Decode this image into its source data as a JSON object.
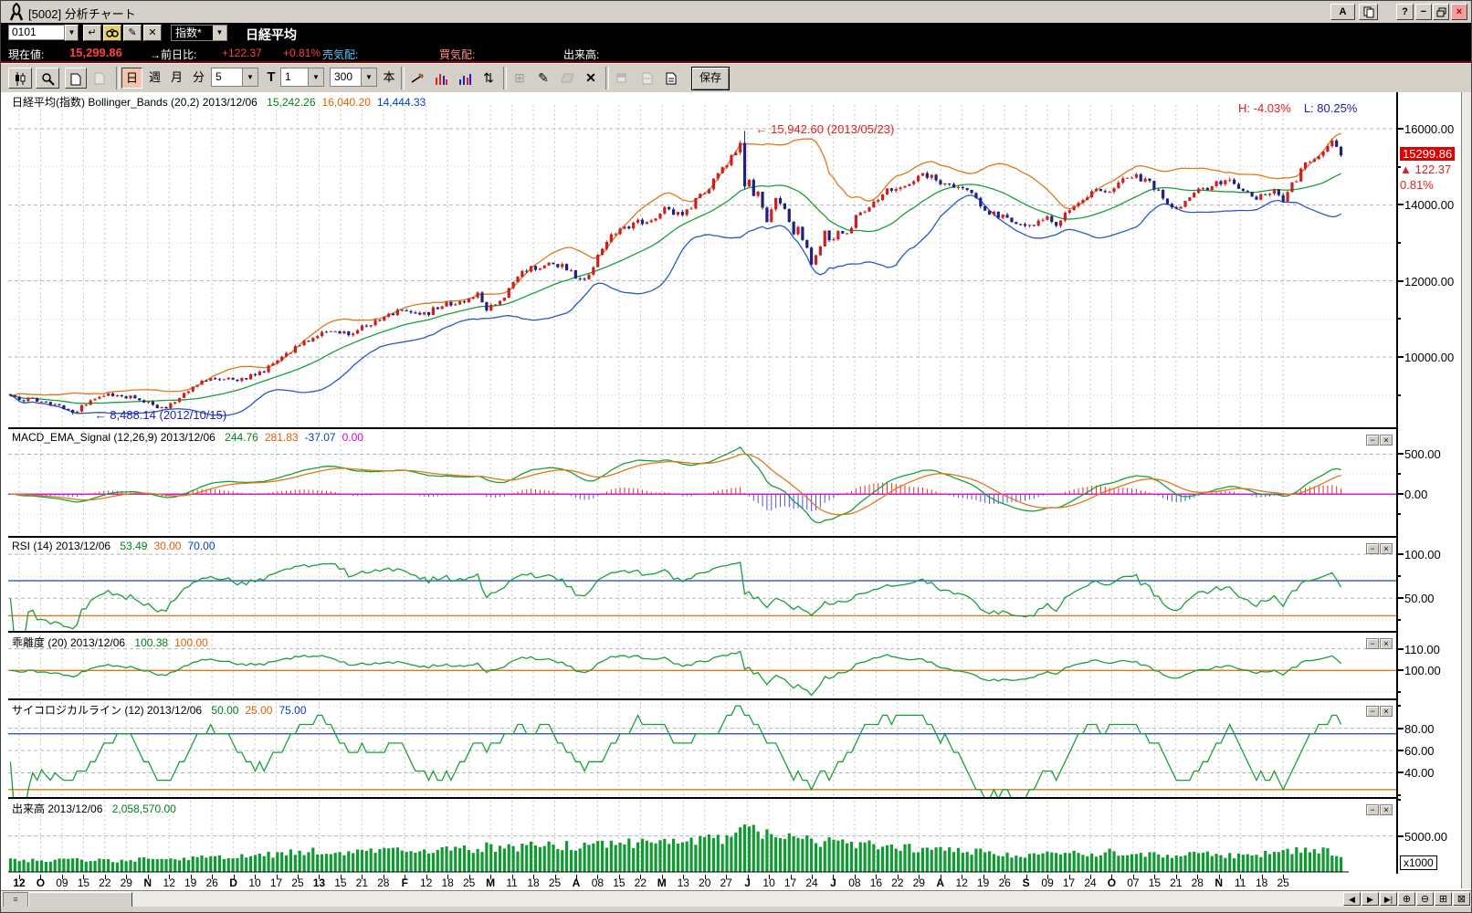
{
  "window": {
    "title": "[5002]  分析チャート",
    "buttons": {
      "font_label": "A",
      "help_label": "?",
      "minimize_label": "−",
      "close_label": "×"
    }
  },
  "quote_bar": {
    "code": "0101",
    "category_select": "指数*",
    "symbol_name": "日経平均",
    "current_label": "現在値:",
    "current_value": "15,299.86",
    "prev_diff_label": "→前日比:",
    "prev_diff_value": "+122.37",
    "prev_diff_pct": "+0.81%",
    "ask_label": "売気配:",
    "bid_label": "買気配:",
    "volume_label": "出来高:"
  },
  "toolbar": {
    "period_day": "日",
    "period_week": "週",
    "period_month": "月",
    "period_minute": "分",
    "minute_value": "5",
    "tick_label": "T",
    "tick_value": "1",
    "bars_value": "300",
    "bars_unit": "本",
    "save_label": "保存"
  },
  "icons": {
    "dropdown": "▼",
    "enter": "↵",
    "pencil": "✎",
    "updown": "⇅",
    "cross": "✕",
    "grid": "⊞",
    "scroll_left": "◀",
    "scroll_right": "▶",
    "scroll_end": "▶|",
    "zoom_in": "⊕",
    "zoom_out": "⊖",
    "box_close": "⊠",
    "grip": "≡"
  },
  "chart_data": {
    "type": "candlestick",
    "bars": 300,
    "panel_buttons": {
      "min": "−",
      "close": "×"
    },
    "panels": [
      {
        "id": "price",
        "label": "日経平均(指数) Bollinger_Bands (20,2) 2013/12/06",
        "values": [
          {
            "t": "15,242.26",
            "c": "#008020"
          },
          {
            "t": "16,040.20",
            "c": "#e06000"
          },
          {
            "t": "14,444.33",
            "c": "#0040d0"
          }
        ],
        "ylim": [
          8176,
          16960
        ],
        "y_ticks": [
          {
            "v": 16000,
            "t": "16000.00"
          },
          {
            "v": 14000,
            "t": "14000.00"
          },
          {
            "v": 12000,
            "t": "12000.00"
          },
          {
            "v": 10000,
            "t": "10000.00"
          }
        ],
        "minor_ticks": [
          15000,
          13000,
          11000,
          9000
        ]
      },
      {
        "id": "macd",
        "label": "MACD_EMA_Signal (12,26,9) 2013/12/06",
        "values": [
          {
            "t": "244.76",
            "c": "#008020"
          },
          {
            "t": "281.83",
            "c": "#e06000"
          },
          {
            "t": "-37.07",
            "c": "#0040d0"
          },
          {
            "t": "0.00",
            "c": "#d000d0"
          }
        ],
        "ylim": [
          -523,
          837
        ],
        "y_ticks": [
          {
            "v": 500,
            "t": "500.00"
          },
          {
            "v": 0,
            "t": "0.00"
          }
        ],
        "minor_ticks": [
          250,
          -250
        ]
      },
      {
        "id": "rsi",
        "label": "RSI (14) 2013/12/06",
        "values": [
          {
            "t": "53.49",
            "c": "#008020"
          },
          {
            "t": "30.00",
            "c": "#e06000"
          },
          {
            "t": "70.00",
            "c": "#0040d0"
          }
        ],
        "ylim": [
          12.8,
          121
        ],
        "y_ticks": [
          {
            "v": 100,
            "t": "100.00"
          },
          {
            "v": 50,
            "t": "50.00"
          }
        ],
        "minor_ticks": [
          75,
          25
        ],
        "levels": [
          {
            "v": 70,
            "c": "#2858c8"
          },
          {
            "v": 30,
            "c": "#e07818"
          }
        ]
      },
      {
        "id": "kairi",
        "label": "乖離度 (20) 2013/12/06",
        "values": [
          {
            "t": "100.38",
            "c": "#008020"
          },
          {
            "t": "100.00",
            "c": "#e06000"
          }
        ],
        "ylim": [
          87,
          118.3
        ],
        "y_ticks": [
          {
            "v": 110,
            "t": "110.00"
          },
          {
            "v": 100,
            "t": "100.00"
          }
        ],
        "minor_ticks": [
          90
        ],
        "levels": [
          {
            "v": 100,
            "c": "#e07818"
          }
        ]
      },
      {
        "id": "psych",
        "label": "サイコロジカルライン (12) 2013/12/06",
        "values": [
          {
            "t": "50.00",
            "c": "#008020"
          },
          {
            "t": "25.00",
            "c": "#e06000"
          },
          {
            "t": "75.00",
            "c": "#0040d0"
          }
        ],
        "ylim": [
          18.3,
          106.7
        ],
        "y_ticks": [
          {
            "v": 80,
            "t": "80.00"
          },
          {
            "v": 60,
            "t": "60.00"
          },
          {
            "v": 40,
            "t": "40.00"
          }
        ],
        "minor_ticks": [
          100,
          20
        ],
        "levels": [
          {
            "v": 75,
            "c": "#2858c8"
          },
          {
            "v": 25,
            "c": "#e07818"
          }
        ]
      },
      {
        "id": "volume",
        "label": "出来高 2013/12/06",
        "values": [
          {
            "t": "2,058,570.00",
            "c": "#008020"
          }
        ],
        "ylim": [
          -250,
          10400
        ],
        "y_ticks": [
          {
            "v": 5000,
            "t": "5000.00"
          }
        ],
        "minor_ticks": [
          10000
        ],
        "unit_label": "x1000"
      }
    ],
    "x_labels": [
      "12",
      "O",
      "09",
      "15",
      "22",
      "29",
      "N",
      "12",
      "19",
      "26",
      "D",
      "10",
      "17",
      "25",
      "13",
      "15",
      "21",
      "28",
      "F",
      "12",
      "18",
      "25",
      "M",
      "11",
      "18",
      "25",
      "A",
      "08",
      "15",
      "22",
      "M",
      "13",
      "20",
      "27",
      "J",
      "10",
      "17",
      "24",
      "J",
      "08",
      "16",
      "22",
      "29",
      "A",
      "12",
      "19",
      "26",
      "S",
      "09",
      "17",
      "24",
      "O",
      "07",
      "15",
      "21",
      "28",
      "N",
      "11",
      "18",
      "25"
    ],
    "x_bold": [
      0,
      1,
      6,
      10,
      14,
      18,
      22,
      26,
      30,
      34,
      38,
      43,
      47,
      51,
      56
    ],
    "annotations": {
      "peak": "← 15,942.60 (2013/05/23)",
      "trough": "← 8,488.14 (2012/10/15)",
      "h_stat": "H: -4.03%",
      "l_stat": "L: 80.25%",
      "last_price": "15299.86",
      "last_change": "▲ 122.37",
      "last_change_pct": "0.81%"
    },
    "key_points": {
      "period_high": 15942.6,
      "period_high_bar": 165,
      "period_low": 8488.14,
      "period_low_bar": 14,
      "last_close": 15299.86,
      "last_volume": 2059
    },
    "close_anchors": [
      [
        0,
        8935
      ],
      [
        3,
        8890
      ],
      [
        6,
        8870
      ],
      [
        9,
        8800
      ],
      [
        12,
        8640
      ],
      [
        14,
        8534
      ],
      [
        16,
        8700
      ],
      [
        19,
        8925
      ],
      [
        22,
        9010
      ],
      [
        25,
        8975
      ],
      [
        28,
        8935
      ],
      [
        31,
        8790
      ],
      [
        33,
        8665
      ],
      [
        35,
        8690
      ],
      [
        38,
        8930
      ],
      [
        41,
        9220
      ],
      [
        44,
        9400
      ],
      [
        47,
        9430
      ],
      [
        50,
        9415
      ],
      [
        53,
        9458
      ],
      [
        56,
        9590
      ],
      [
        59,
        9780
      ],
      [
        62,
        10050
      ],
      [
        64,
        10230
      ],
      [
        66,
        10400
      ],
      [
        68,
        10520
      ],
      [
        70,
        10640
      ],
      [
        72,
        10710
      ],
      [
        74,
        10680
      ],
      [
        76,
        10610
      ],
      [
        78,
        10720
      ],
      [
        80,
        10860
      ],
      [
        82,
        10920
      ],
      [
        84,
        11090
      ],
      [
        86,
        11170
      ],
      [
        88,
        11255
      ],
      [
        90,
        11190
      ],
      [
        92,
        11110
      ],
      [
        94,
        11170
      ],
      [
        96,
        11310
      ],
      [
        98,
        11410
      ],
      [
        100,
        11340
      ],
      [
        102,
        11500
      ],
      [
        104,
        11620
      ],
      [
        105,
        11660
      ],
      [
        107,
        11255
      ],
      [
        109,
        11410
      ],
      [
        111,
        11610
      ],
      [
        113,
        12020
      ],
      [
        115,
        12240
      ],
      [
        117,
        12320
      ],
      [
        119,
        12380
      ],
      [
        121,
        12470
      ],
      [
        123,
        12400
      ],
      [
        125,
        12340
      ],
      [
        127,
        12100
      ],
      [
        129,
        12010
      ],
      [
        131,
        12400
      ],
      [
        133,
        12830
      ],
      [
        135,
        13190
      ],
      [
        137,
        13300
      ],
      [
        139,
        13440
      ],
      [
        141,
        13540
      ],
      [
        143,
        13550
      ],
      [
        145,
        13700
      ],
      [
        147,
        13885
      ],
      [
        149,
        13820
      ],
      [
        151,
        13690
      ],
      [
        153,
        13930
      ],
      [
        155,
        14285
      ],
      [
        157,
        14490
      ],
      [
        159,
        14780
      ],
      [
        161,
        15100
      ],
      [
        163,
        15380
      ],
      [
        164,
        15627
      ],
      [
        165,
        14484
      ],
      [
        166,
        14612
      ],
      [
        167,
        14160
      ],
      [
        168,
        14350
      ],
      [
        170,
        13590
      ],
      [
        171,
        13920
      ],
      [
        172,
        14160
      ],
      [
        173,
        14050
      ],
      [
        174,
        13840
      ],
      [
        175,
        13580
      ],
      [
        176,
        13290
      ],
      [
        177,
        13430
      ],
      [
        178,
        13015
      ],
      [
        179,
        12905
      ],
      [
        180,
        12450
      ],
      [
        181,
        12690
      ],
      [
        182,
        12970
      ],
      [
        183,
        13240
      ],
      [
        184,
        13015
      ],
      [
        185,
        13110
      ],
      [
        186,
        13320
      ],
      [
        187,
        13250
      ],
      [
        188,
        13230
      ],
      [
        189,
        13410
      ],
      [
        190,
        13680
      ],
      [
        192,
        13870
      ],
      [
        194,
        14060
      ],
      [
        196,
        14310
      ],
      [
        198,
        14420
      ],
      [
        200,
        14470
      ],
      [
        202,
        14510
      ],
      [
        204,
        14710
      ],
      [
        205,
        14810
      ],
      [
        207,
        14720
      ],
      [
        209,
        14620
      ],
      [
        211,
        14560
      ],
      [
        213,
        14500
      ],
      [
        215,
        14470
      ],
      [
        217,
        14090
      ],
      [
        219,
        13910
      ],
      [
        220,
        13830
      ],
      [
        222,
        13690
      ],
      [
        224,
        13610
      ],
      [
        226,
        13520
      ],
      [
        228,
        13420
      ],
      [
        230,
        13370
      ],
      [
        232,
        13660
      ],
      [
        234,
        13570
      ],
      [
        235,
        13460
      ],
      [
        237,
        13790
      ],
      [
        239,
        14000
      ],
      [
        241,
        14070
      ],
      [
        243,
        14310
      ],
      [
        245,
        14430
      ],
      [
        247,
        14390
      ],
      [
        249,
        14620
      ],
      [
        251,
        14770
      ],
      [
        253,
        14730
      ],
      [
        255,
        14620
      ],
      [
        257,
        14460
      ],
      [
        259,
        14170
      ],
      [
        261,
        13980
      ],
      [
        262,
        13860
      ],
      [
        264,
        14110
      ],
      [
        266,
        14240
      ],
      [
        268,
        14440
      ],
      [
        270,
        14520
      ],
      [
        272,
        14590
      ],
      [
        274,
        14690
      ],
      [
        276,
        14490
      ],
      [
        278,
        14330
      ],
      [
        280,
        14200
      ],
      [
        282,
        14290
      ],
      [
        284,
        14340
      ],
      [
        286,
        14090
      ],
      [
        288,
        14500
      ],
      [
        290,
        14880
      ],
      [
        292,
        15170
      ],
      [
        294,
        15370
      ],
      [
        296,
        15520
      ],
      [
        297,
        15660
      ],
      [
        298,
        15520
      ],
      [
        299,
        15299.86
      ]
    ],
    "volume_anchors": [
      [
        0,
        1650
      ],
      [
        8,
        1500
      ],
      [
        16,
        1750
      ],
      [
        24,
        1600
      ],
      [
        32,
        1800
      ],
      [
        40,
        1950
      ],
      [
        48,
        2050
      ],
      [
        56,
        2250
      ],
      [
        62,
        2600
      ],
      [
        68,
        2850
      ],
      [
        74,
        2650
      ],
      [
        80,
        2750
      ],
      [
        86,
        2950
      ],
      [
        92,
        2800
      ],
      [
        98,
        3050
      ],
      [
        104,
        3250
      ],
      [
        107,
        3500
      ],
      [
        112,
        3300
      ],
      [
        118,
        3600
      ],
      [
        124,
        3700
      ],
      [
        129,
        3450
      ],
      [
        135,
        4100
      ],
      [
        141,
        4000
      ],
      [
        147,
        4200
      ],
      [
        153,
        4100
      ],
      [
        159,
        4500
      ],
      [
        163,
        5100
      ],
      [
        165,
        5900
      ],
      [
        168,
        5400
      ],
      [
        172,
        5100
      ],
      [
        176,
        4700
      ],
      [
        180,
        4400
      ],
      [
        184,
        4100
      ],
      [
        188,
        3700
      ],
      [
        192,
        3900
      ],
      [
        196,
        3600
      ],
      [
        200,
        3400
      ],
      [
        204,
        3300
      ],
      [
        208,
        3100
      ],
      [
        212,
        2950
      ],
      [
        216,
        2800
      ],
      [
        220,
        2650
      ],
      [
        224,
        2450
      ],
      [
        228,
        2350
      ],
      [
        232,
        2500
      ],
      [
        236,
        2650
      ],
      [
        240,
        2750
      ],
      [
        244,
        2600
      ],
      [
        248,
        2850
      ],
      [
        252,
        2550
      ],
      [
        256,
        2350
      ],
      [
        260,
        2300
      ],
      [
        264,
        2450
      ],
      [
        268,
        2550
      ],
      [
        272,
        2400
      ],
      [
        276,
        2300
      ],
      [
        280,
        2450
      ],
      [
        284,
        2650
      ],
      [
        288,
        3050
      ],
      [
        292,
        3150
      ],
      [
        296,
        2900
      ],
      [
        299,
        2059
      ]
    ],
    "colors": {
      "up": "#cc2020",
      "down": "#202080",
      "bb_upper": "#e07818",
      "bb_mid": "#18a038",
      "bb_lower": "#2858c8",
      "macd": "#18a038",
      "signal": "#e07818",
      "hist_pos": "#e03030",
      "hist_neg": "#5050e0",
      "zero": "#d818d8",
      "rsi": "#18a038",
      "kairi": "#18a038",
      "psych": "#18a038",
      "volume": "#0f9a32",
      "grid": "#c8c8c8",
      "tag_bg": "#e00000"
    }
  }
}
